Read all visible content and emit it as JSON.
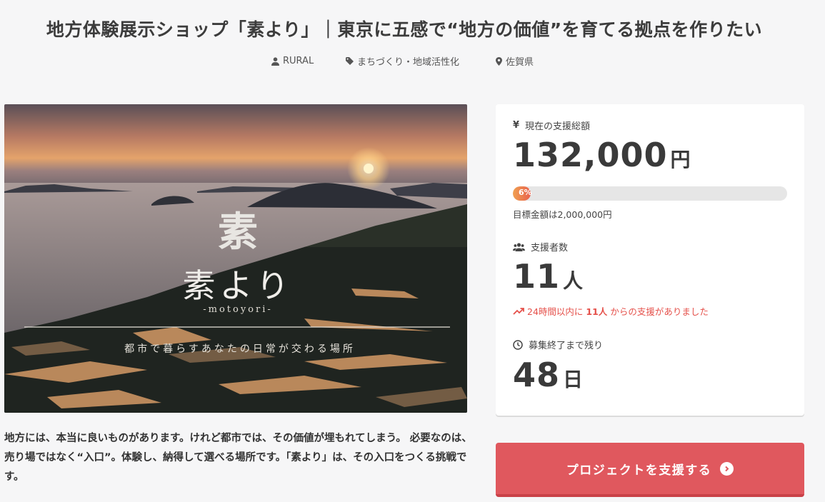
{
  "project": {
    "title": "地方体験展示ショップ「素より」｜東京に五感で“地方の価値”を育てる拠点を作りたい",
    "owner": "RURAL",
    "category": "まちづくり・地域活性化",
    "location": "佐賀県"
  },
  "hero": {
    "logo_kanji": "素",
    "name": "素より",
    "romaji": "-motoyori-",
    "tagline": "都市で暮らすあなたの日常が交わる場所"
  },
  "description": "地方には、本当に良いものがあります。けれど都市では、その価値が埋もれてしまう。 必要なのは、売り場ではなく“入口”。体験し、納得して選べる場所です。「素より」は、その入口をつくる挑戦です。",
  "funding": {
    "amount_label": "現在の支援総額",
    "amount": "132,000",
    "amount_unit": "円",
    "percent": 6,
    "percent_text": "6%",
    "goal": "目標金額は2,000,000円",
    "supporters_label": "支援者数",
    "supporters": "11",
    "supporters_unit": "人",
    "recent_prefix": "24時間以内に",
    "recent_count": "11人",
    "recent_suffix": "からの支援がありました",
    "remaining_label": "募集終了まで残り",
    "remaining": "48",
    "remaining_unit": "日"
  },
  "cta": {
    "label": "プロジェクトを支援する"
  },
  "icons": {
    "owner": "user-icon",
    "category": "tag-icon",
    "location": "pin-icon",
    "amount": "yen-icon",
    "supporters": "users-icon",
    "recent": "trend-up-icon",
    "remaining": "clock-icon",
    "cta": "chevron-circle-right-icon"
  },
  "colors": {
    "accent": "#e0585e",
    "trend": "#e5504a",
    "progress": "#e8604c"
  }
}
